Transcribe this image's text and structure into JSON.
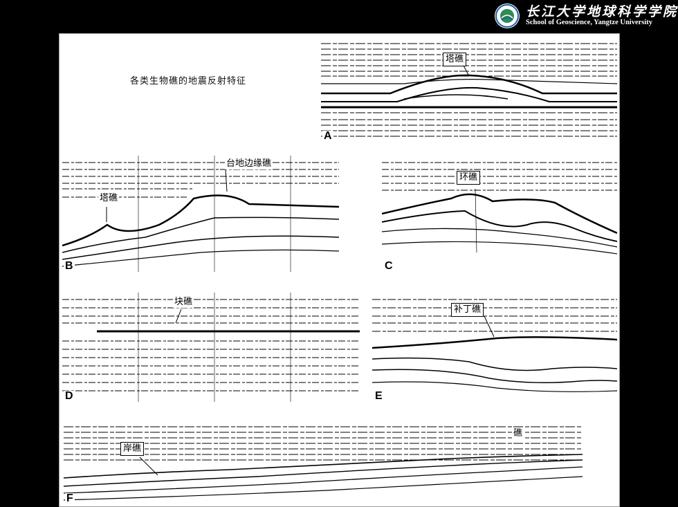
{
  "header": {
    "title_cn": "长江大学地球科学学院",
    "title_en": "School of Geoscience, Yangtze University",
    "logo_icon": "university-seal-icon"
  },
  "figure": {
    "title": "各类生物礁的地震反射特征",
    "panels": [
      {
        "id": "A",
        "label": "塔礁"
      },
      {
        "id": "B",
        "labels": [
          "台地边缘礁",
          "塔礁"
        ]
      },
      {
        "id": "C",
        "label": "环礁"
      },
      {
        "id": "D",
        "label": "块礁"
      },
      {
        "id": "E",
        "label": "补丁礁"
      },
      {
        "id": "F",
        "labels": [
          "岸礁",
          "礁"
        ]
      }
    ]
  }
}
